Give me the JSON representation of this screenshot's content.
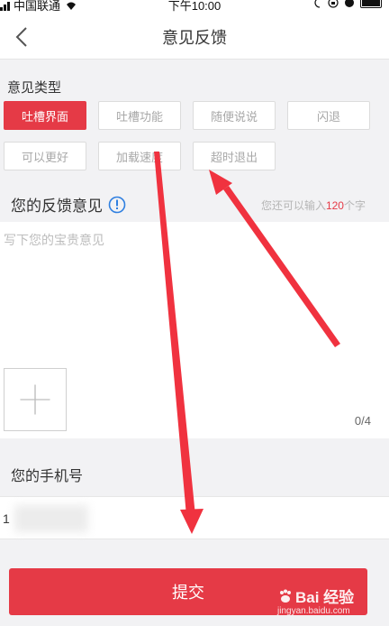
{
  "status_bar": {
    "carrier": "中国联通",
    "time": "下午10:00"
  },
  "nav": {
    "title": "意见反馈",
    "back_icon": "chevron-left-icon"
  },
  "feedback_types": {
    "label": "意见类型",
    "options": [
      {
        "label": "吐槽界面",
        "selected": true
      },
      {
        "label": "吐槽功能",
        "selected": false
      },
      {
        "label": "随便说说",
        "selected": false
      },
      {
        "label": "闪退",
        "selected": false
      },
      {
        "label": "可以更好",
        "selected": false
      },
      {
        "label": "加载速度",
        "selected": false
      },
      {
        "label": "超时退出",
        "selected": false
      }
    ]
  },
  "feedback": {
    "title": "您的反馈意见",
    "info_icon": "info-circle-icon",
    "remaining_prefix": "您还可以输入",
    "remaining_count": "120",
    "remaining_suffix": "个字",
    "placeholder": "写下您的宝贵意见",
    "image_count": "0/4",
    "add_image_icon": "plus-icon"
  },
  "phone": {
    "label": "您的手机号",
    "value": "1"
  },
  "submit": {
    "label": "提交"
  },
  "watermark": {
    "brand": "Bai 经验",
    "url": "jingyan.baidu.com"
  },
  "colors": {
    "accent": "#e53a46",
    "annotation_arrow": "#f0323f",
    "background": "#f2f2f4"
  }
}
